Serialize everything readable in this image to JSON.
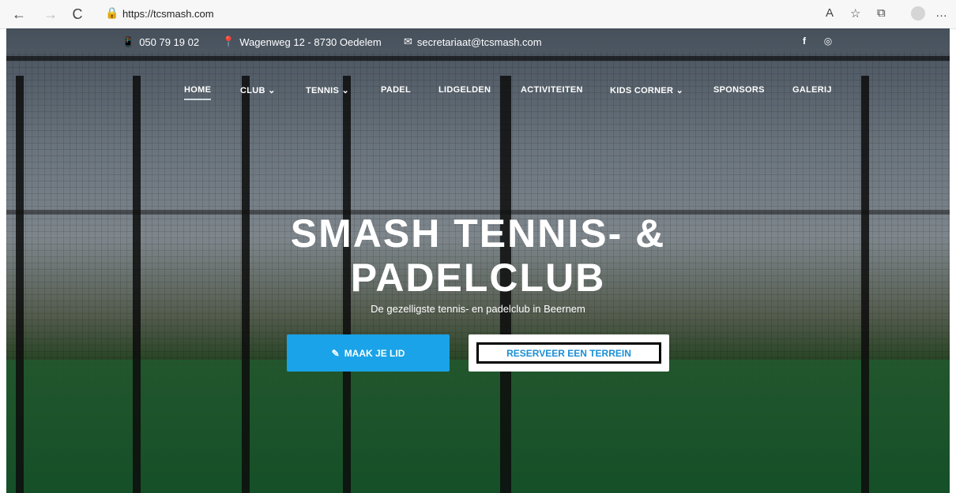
{
  "browser": {
    "url": "https://tcsmash.com",
    "back_icon": "←",
    "forward_icon": "→",
    "refresh_icon": "C",
    "lock_icon": "lock-icon",
    "more_icon": "…"
  },
  "topbar": {
    "phone": "050 79 19 02",
    "address": "Wagenweg 12 - 8730 Oedelem",
    "email": "secretariaat@tcsmash.com"
  },
  "nav": {
    "home": "HOME",
    "club": "CLUB",
    "tennis": "TENNIS",
    "padel": "PADEL",
    "lidgelden": "LIDGELDEN",
    "activiteiten": "ACTIVITEITEN",
    "kids": "KIDS CORNER",
    "sponsors": "SPONSORS",
    "galerij": "GALERIJ"
  },
  "hero": {
    "title_line1": "SMASH TENNIS- &",
    "title_line2": "PADELCLUB",
    "subtitle": "De gezelligste tennis- en padelclub in Beernem",
    "join_label": "MAAK JE LID",
    "reserve_label": "RESERVEER EEN TERREIN"
  },
  "colors": {
    "accent": "#1aa3e8",
    "reserve_text": "#1a8fd6"
  }
}
